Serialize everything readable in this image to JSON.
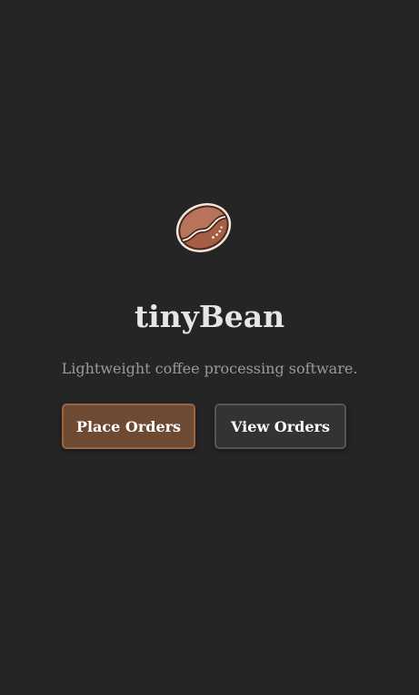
{
  "app": {
    "title": "tinyBean",
    "tagline": "Lightweight coffee processing software.",
    "logo_icon": "coffee-bean-icon"
  },
  "actions": {
    "place_orders_label": "Place Orders",
    "view_orders_label": "View Orders"
  },
  "colors": {
    "background": "#252525",
    "primary_button": "#6e4a33",
    "primary_button_border": "#9a6543",
    "secondary_button": "#333333",
    "secondary_button_border": "#555555",
    "title_text": "#e6e6e6",
    "tagline_text": "#9a9a9a"
  }
}
